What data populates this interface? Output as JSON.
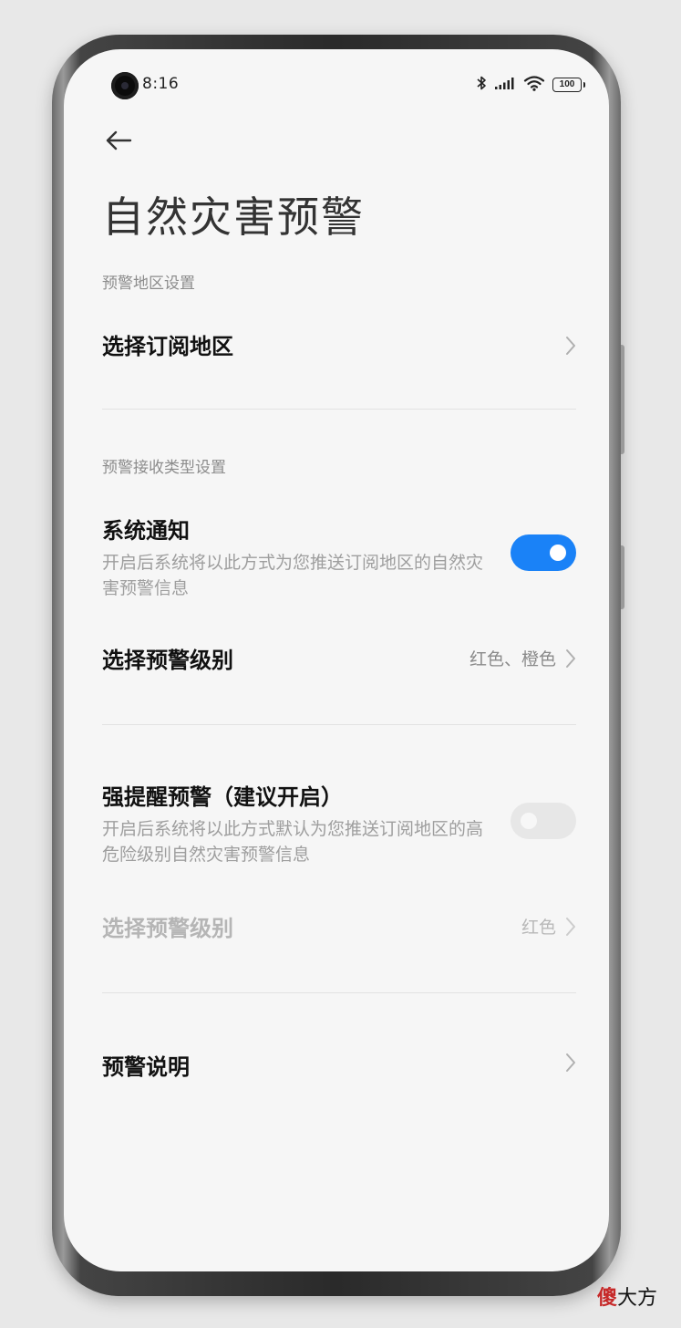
{
  "status_bar": {
    "time": "8:16",
    "battery": "100"
  },
  "header": {
    "title": "自然灾害预警"
  },
  "sections": {
    "region": {
      "header": "预警地区设置",
      "select_region_label": "选择订阅地区"
    },
    "receive": {
      "header": "预警接收类型设置",
      "system_notification": {
        "title": "系统通知",
        "description": "开启后系统将以此方式为您推送订阅地区的自然灾害预警信息",
        "enabled": true
      },
      "level_select": {
        "label": "选择预警级别",
        "value": "红色、橙色"
      }
    },
    "strong_alert": {
      "title": "强提醒预警（建议开启）",
      "description": "开启后系统将以此方式默认为您推送订阅地区的高危险级别自然灾害预警信息",
      "enabled": false,
      "level_select": {
        "label": "选择预警级别",
        "value": "红色"
      }
    },
    "info": {
      "label": "预警说明"
    }
  },
  "watermark": {
    "logo_char": "傻",
    "text": "大方"
  },
  "colors": {
    "accent": "#1a82f7",
    "background": "#f6f6f6"
  }
}
